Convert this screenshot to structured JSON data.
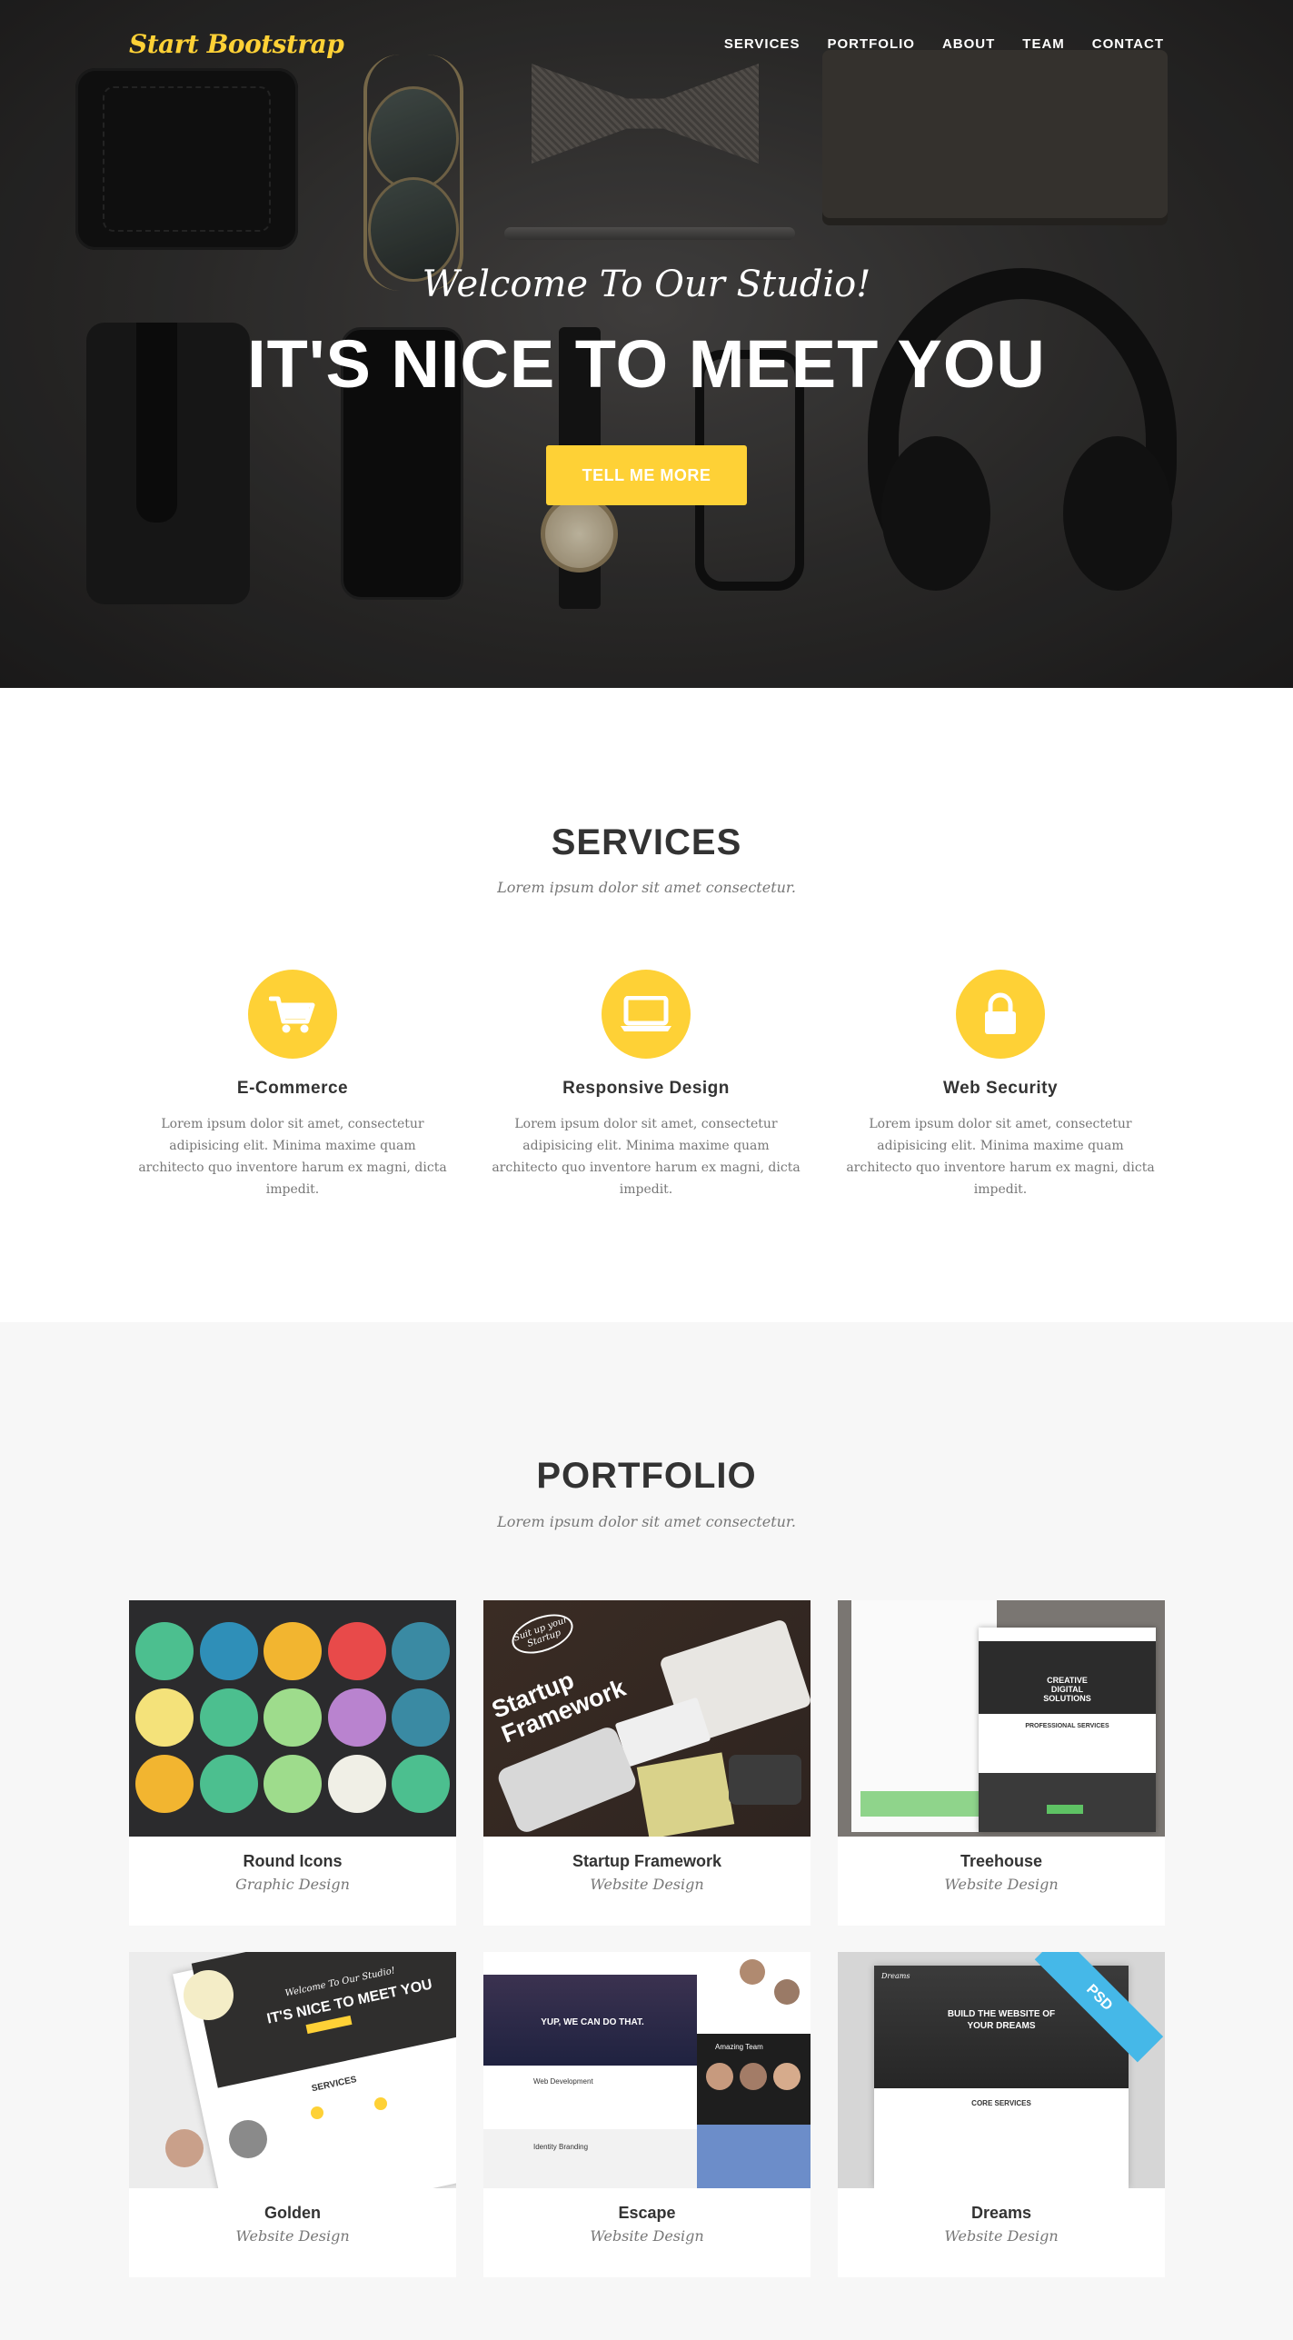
{
  "brand": "Start Bootstrap",
  "nav": [
    "SERVICES",
    "PORTFOLIO",
    "ABOUT",
    "TEAM",
    "CONTACT"
  ],
  "hero": {
    "subtitle": "Welcome To Our Studio!",
    "title": "IT'S NICE TO MEET YOU",
    "button": "TELL ME MORE"
  },
  "services": {
    "title": "SERVICES",
    "subtitle": "Lorem ipsum dolor sit amet consectetur.",
    "items": [
      {
        "icon": "shopping-cart-icon",
        "name": "E-Commerce",
        "text": "Lorem ipsum dolor sit amet, consectetur adipisicing elit. Minima maxime quam architecto quo inventore harum ex magni, dicta impedit."
      },
      {
        "icon": "laptop-icon",
        "name": "Responsive Design",
        "text": "Lorem ipsum dolor sit amet, consectetur adipisicing elit. Minima maxime quam architecto quo inventore harum ex magni, dicta impedit."
      },
      {
        "icon": "lock-icon",
        "name": "Web Security",
        "text": "Lorem ipsum dolor sit amet, consectetur adipisicing elit. Minima maxime quam architecto quo inventore harum ex magni, dicta impedit."
      }
    ]
  },
  "portfolio": {
    "title": "PORTFOLIO",
    "subtitle": "Lorem ipsum dolor sit amet consectetur.",
    "items": [
      {
        "title": "Round Icons",
        "category": "Graphic Design"
      },
      {
        "title": "Startup Framework",
        "category": "Website Design"
      },
      {
        "title": "Treehouse",
        "category": "Website Design"
      },
      {
        "title": "Golden",
        "category": "Website Design"
      },
      {
        "title": "Escape",
        "category": "Website Design"
      },
      {
        "title": "Dreams",
        "category": "Website Design"
      }
    ],
    "thumb_text": {
      "startup": "Startup Framework",
      "startup_badge": "Suit up your Startup",
      "treehouse_head": "CREATIVE DIGITAL SOLUTIONS",
      "treehouse_services": "PROFESSIONAL SERVICES",
      "golden_sub": "Welcome To Our Studio!",
      "golden_title": "IT'S NICE TO MEET YOU",
      "golden_services": "SERVICES",
      "escape_hero": "YUP, WE CAN DO THAT.",
      "escape_web": "Web Development",
      "escape_identity": "Identity Branding",
      "escape_team": "Amazing Team",
      "dreams_brand": "Dreams",
      "dreams_title": "BUILD THE WEBSITE OF YOUR DREAMS",
      "dreams_services": "CORE SERVICES",
      "dreams_ribbon": "PSD"
    }
  },
  "colors": {
    "accent": "#fed136",
    "dark": "#333333",
    "muted": "#777777",
    "light_bg": "#f7f7f7"
  }
}
